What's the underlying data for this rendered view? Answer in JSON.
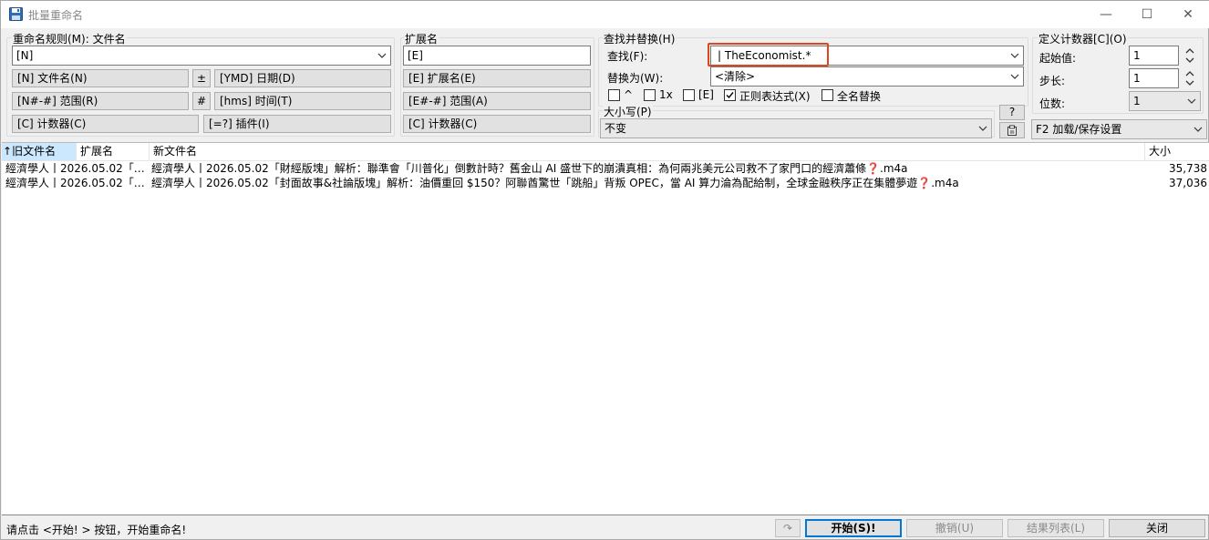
{
  "window": {
    "title": "批量重命名",
    "minimize_glyph": "—",
    "maximize_glyph": "☐",
    "close_glyph": "✕"
  },
  "rule": {
    "group_label": "重命名规则(M): 文件名",
    "value": "[N]",
    "buttons": {
      "filename": "[N] 文件名(N)",
      "plusminus": "±",
      "date": "[YMD] 日期(D)",
      "range": "[N#-#] 范围(R)",
      "hash": "#",
      "time": "[hms] 时间(T)",
      "counter": "[C] 计数器(C)",
      "plugin": "[=?] 插件(I)"
    }
  },
  "ext": {
    "group_label": "扩展名",
    "value": "[E]",
    "buttons": {
      "ext": "[E] 扩展名(E)",
      "range": "[E#-#] 范围(A)",
      "counter": "[C] 计数器(C)"
    }
  },
  "find": {
    "group_label": "查找并替换(H)",
    "find_label": "查找(F):",
    "find_value": "| TheEconomist.*",
    "replace_label": "替换为(W):",
    "replace_value": "<清除>",
    "options": [
      {
        "label": "^",
        "checked": false
      },
      {
        "label": "1x",
        "checked": false
      },
      {
        "label": "[E]",
        "checked": false
      },
      {
        "label": "正则表达式(X)",
        "checked": true
      },
      {
        "label": "全名替换",
        "checked": false
      }
    ],
    "case_label": "大小写(P)",
    "case_value": "不变",
    "help_label": "?"
  },
  "counter": {
    "group_label": "定义计数器[C](O)",
    "start_label": "起始值:",
    "start_value": "1",
    "step_label": "步长:",
    "step_value": "1",
    "digits_label": "位数:",
    "digits_value": "1",
    "settings_value": "F2 加载/保存设置"
  },
  "list": {
    "columns": [
      "旧文件名",
      "扩展名",
      "新文件名",
      "大小"
    ],
    "sort_arrow": "↑",
    "rows": [
      {
        "old": "經濟學人丨2026.05.02「…",
        "ext": "",
        "new": "經濟學人丨2026.05.02「財經版塊」解析：聯準會「川普化」倒數計時？舊金山 AI 盛世下的崩潰真相：為何兩兆美元公司救不了家門口的經濟蕭條❓.m4a",
        "size": "35,738"
      },
      {
        "old": "經濟學人丨2026.05.02「…",
        "ext": "",
        "new": "經濟學人丨2026.05.02「封面故事&社論版塊」解析：油價重回 $150？阿聯酋驚世「跳船」背叛 OPEC，當 AI 算力淪為配給制，全球金融秩序正在集體夢遊❓.m4a",
        "size": "37,036"
      }
    ]
  },
  "status": {
    "text": "请点击 <开始! > 按钮，开始重命名!",
    "undo_icon": "↷",
    "start": "开始(S)!",
    "revert": "撤销(U)",
    "results": "结果列表(L)",
    "close": "关闭"
  },
  "colors": {
    "highlight_border": "#d9481f",
    "selected_header": "#cce8ff"
  }
}
